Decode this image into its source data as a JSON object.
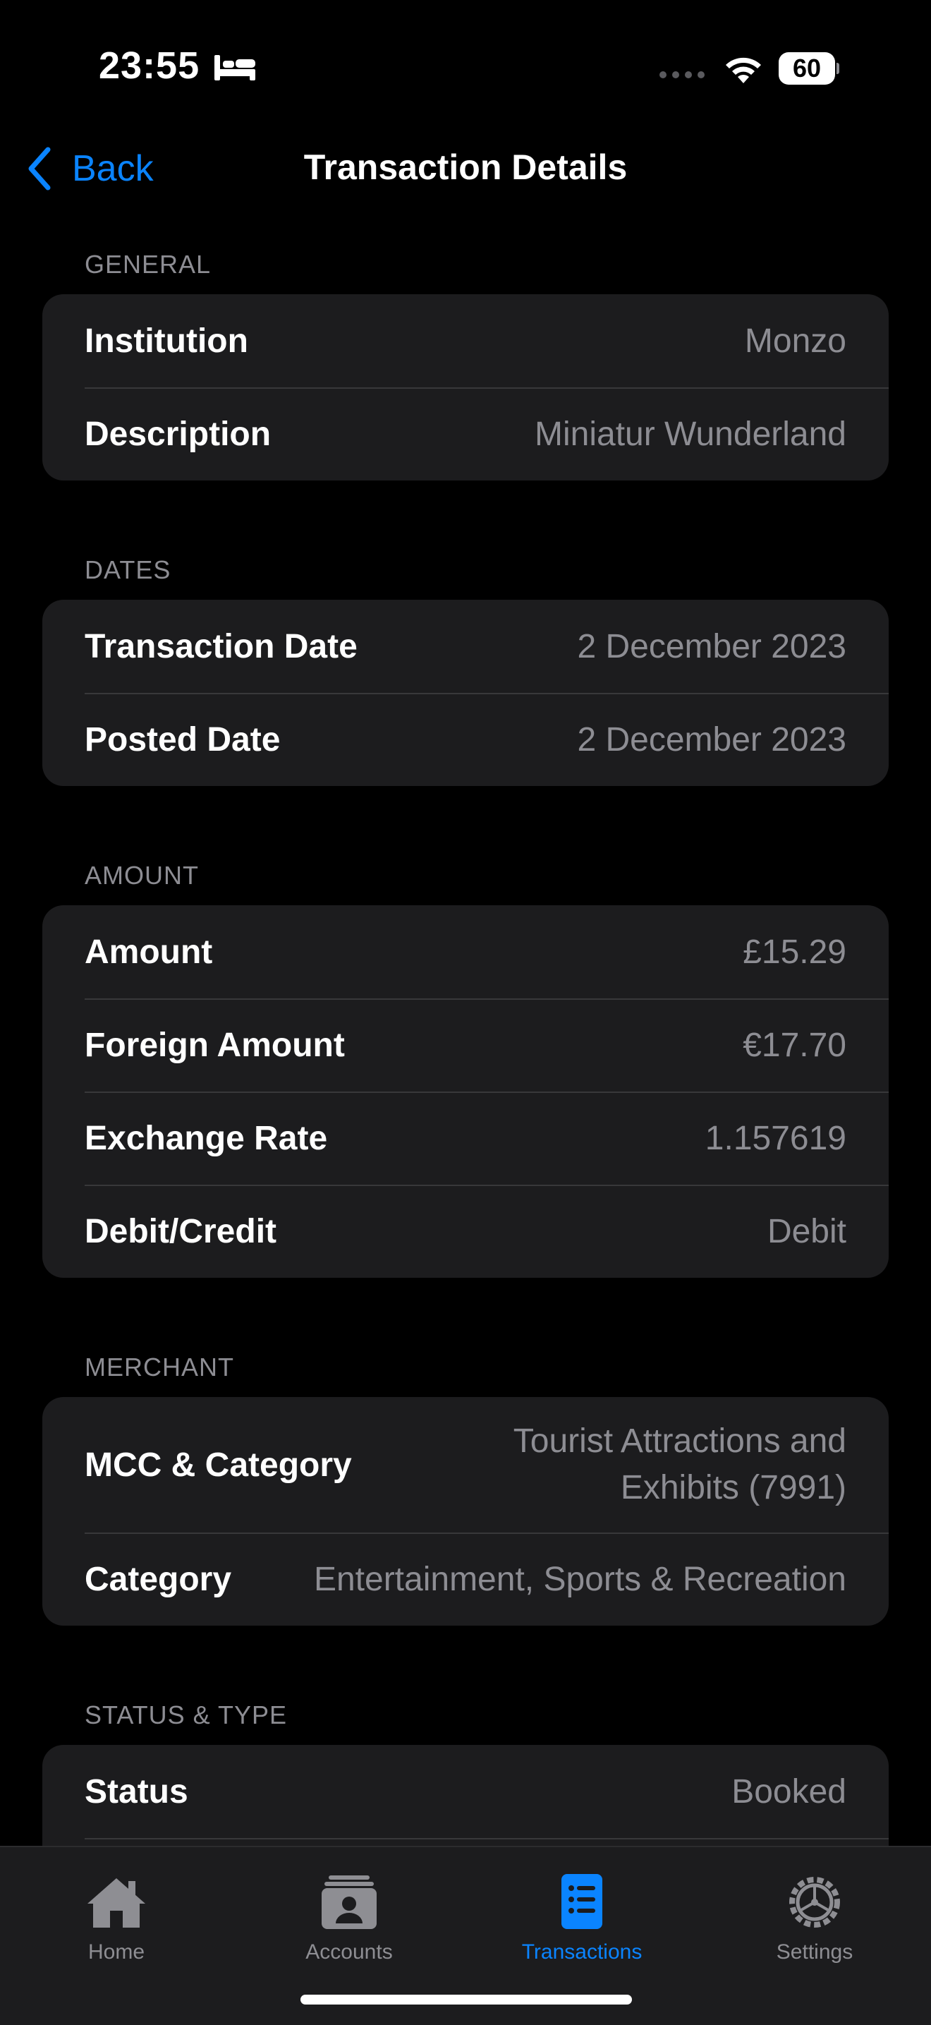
{
  "status_bar": {
    "time": "23:55",
    "battery": "60",
    "icons": [
      "bed-icon",
      "cellular-signal-icon",
      "wifi-icon",
      "battery-icon"
    ]
  },
  "nav": {
    "back_label": "Back",
    "title": "Transaction Details"
  },
  "sections": {
    "general": {
      "header": "GENERAL",
      "rows": [
        {
          "label": "Institution",
          "value": "Monzo"
        },
        {
          "label": "Description",
          "value": "Miniatur Wunderland"
        }
      ]
    },
    "dates": {
      "header": "DATES",
      "rows": [
        {
          "label": "Transaction Date",
          "value": "2 December 2023"
        },
        {
          "label": "Posted Date",
          "value": "2 December 2023"
        }
      ]
    },
    "amount": {
      "header": "AMOUNT",
      "rows": [
        {
          "label": "Amount",
          "value": "£15.29"
        },
        {
          "label": "Foreign Amount",
          "value": "€17.70"
        },
        {
          "label": "Exchange Rate",
          "value": "1.157619"
        },
        {
          "label": "Debit/Credit",
          "value": "Debit"
        }
      ]
    },
    "merchant": {
      "header": "MERCHANT",
      "rows": [
        {
          "label": "MCC & Category",
          "value": "Tourist Attractions and Exhibits (7991)"
        },
        {
          "label": "Category",
          "value": "Entertainment, Sports & Recreation"
        }
      ]
    },
    "status_type": {
      "header": "STATUS & TYPE",
      "rows": [
        {
          "label": "Status",
          "value": "Booked"
        }
      ]
    }
  },
  "tab_bar": {
    "tabs": [
      {
        "label": "Home",
        "icon": "house-icon",
        "active": false
      },
      {
        "label": "Accounts",
        "icon": "accounts-icon",
        "active": false
      },
      {
        "label": "Transactions",
        "icon": "list-icon",
        "active": true
      },
      {
        "label": "Settings",
        "icon": "gear-icon",
        "active": false
      }
    ]
  },
  "colors": {
    "background": "#000000",
    "card": "#1c1c1e",
    "accent": "#0a84ff",
    "secondary_text": "#8d8d93"
  }
}
